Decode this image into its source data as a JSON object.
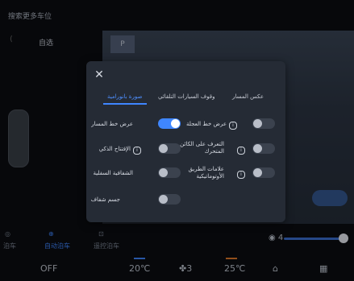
{
  "top_bar": {
    "title": "搜索更多车位"
  },
  "mode_label": "自选",
  "camera": {
    "sign": "P",
    "icon": "parking-camera"
  },
  "bottom": {
    "off_label": "OFF",
    "temp_left": "20℃",
    "fan_level": "3",
    "temp_right": "25℃",
    "brightness_value": "4",
    "left_icon_labels": [
      "泊车",
      "自动泊车",
      "遥控泊车"
    ]
  },
  "modal": {
    "tabs": [
      {
        "label": "صورة بانورامية",
        "active": true
      },
      {
        "label": "وقوف السيارات التلقائي",
        "active": false
      },
      {
        "label": "عكس المسار",
        "active": false
      }
    ],
    "rows": [
      {
        "label": "عرض خط المسار",
        "on": true,
        "info": false
      },
      {
        "label": "عرض خط العجلة",
        "on": false,
        "info": true
      },
      {
        "label": "الإفتتاح الذكي",
        "on": false,
        "info": true
      },
      {
        "label": "التعرف على الكائن المتحرك",
        "on": false,
        "info": true
      },
      {
        "label": "الشفافية السفلية",
        "on": false,
        "info": false
      },
      {
        "label": "علامات الطريق الأوتوماتيكية",
        "on": false,
        "info": true
      },
      {
        "label": "جسم شفاف",
        "on": false,
        "info": false
      }
    ],
    "close_icon": "close-icon"
  },
  "colors": {
    "accent": "#3f86ff",
    "modal_bg": "#252b35"
  }
}
